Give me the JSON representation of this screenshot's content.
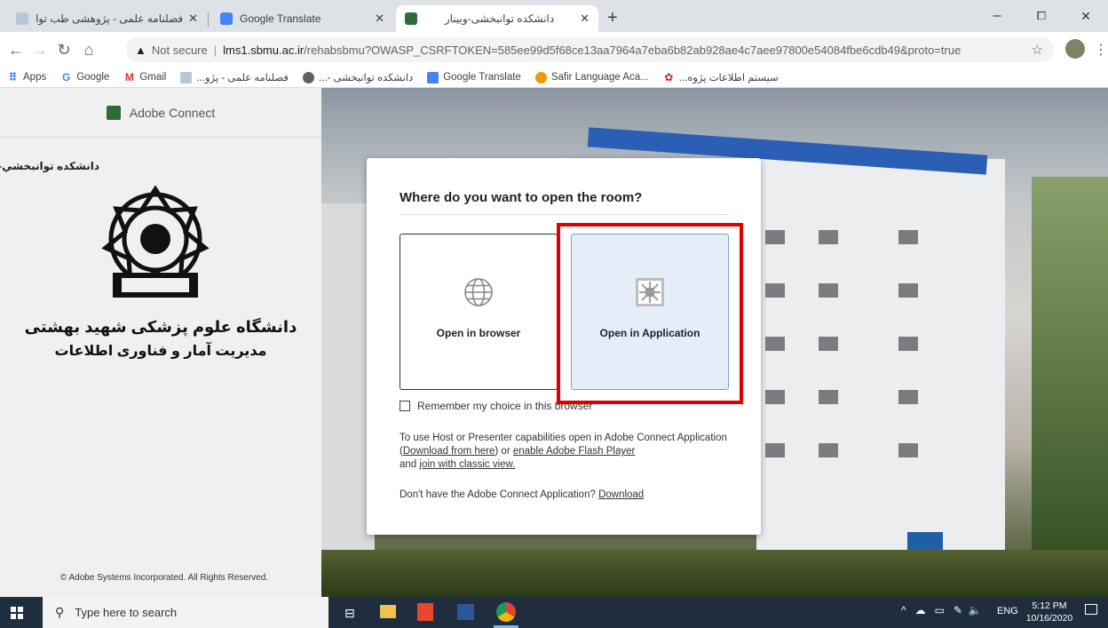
{
  "tabs": [
    {
      "title": "فصلنامه علمی - پژوهشی طب توان",
      "active": false
    },
    {
      "title": "Google Translate",
      "active": false
    },
    {
      "title": "دانشکده توانبخشی-وبینار",
      "active": true
    }
  ],
  "window_controls": {
    "minimize": "–",
    "maximize": "⧠",
    "close": "✕"
  },
  "address_bar": {
    "security_label": "Not secure",
    "host": "lms1.sbmu.ac.ir",
    "path": "/rehabsbmu?OWASP_CSRFTOKEN=585ee99d5f68ce13aa7964a7eba6b82ab928ae4c7aee97800e54084fbe6cdb49&proto=true"
  },
  "bookmarks": [
    {
      "label": "Apps",
      "icon": "apps-grid-icon"
    },
    {
      "label": "Google",
      "icon": "google-g-icon"
    },
    {
      "label": "Gmail",
      "icon": "gmail-m-icon"
    },
    {
      "label": "فصلنامه علمی - پژو...",
      "icon": "journal-icon"
    },
    {
      "label": "دانشکده توانبخشی -...",
      "icon": "globe-icon"
    },
    {
      "label": "Google Translate",
      "icon": "translate-icon"
    },
    {
      "label": "Safir Language Aca...",
      "icon": "safir-icon"
    },
    {
      "label": "سیستم اطلاعات پژوه...",
      "icon": "research-system-icon"
    }
  ],
  "sidebar": {
    "product_name": "Adobe Connect",
    "room_name": "دانشكده توانبخشي-وبينار",
    "university_line1": "دانشگاه علوم پزشکی شهید بهشتی",
    "university_line2": "مدیریت آمار و فناوری اطلاعات",
    "copyright": "© Adobe Systems Incorporated. All Rights Reserved."
  },
  "dialog": {
    "title": "Where do you want to open the room?",
    "option_browser": "Open in browser",
    "option_app": "Open in Application",
    "remember_label": "Remember my choice in this browser",
    "remember_checked": false,
    "info_text_1": "To use Host or Presenter capabilities open in Adobe Connect Application (",
    "download_from_here": "Download from here",
    "info_text_2": ") or ",
    "enable_flash": "enable Adobe Flash Player",
    "info_text_3": "and ",
    "classic_view": "join with classic view.",
    "no_app_text": "Don't have the Adobe Connect Application? ",
    "download_link": "Download",
    "highlight_color": "#e00000"
  },
  "taskbar": {
    "search_placeholder": "Type here to search",
    "language": "ENG",
    "time": "5:12 PM",
    "date": "10/16/2020"
  }
}
